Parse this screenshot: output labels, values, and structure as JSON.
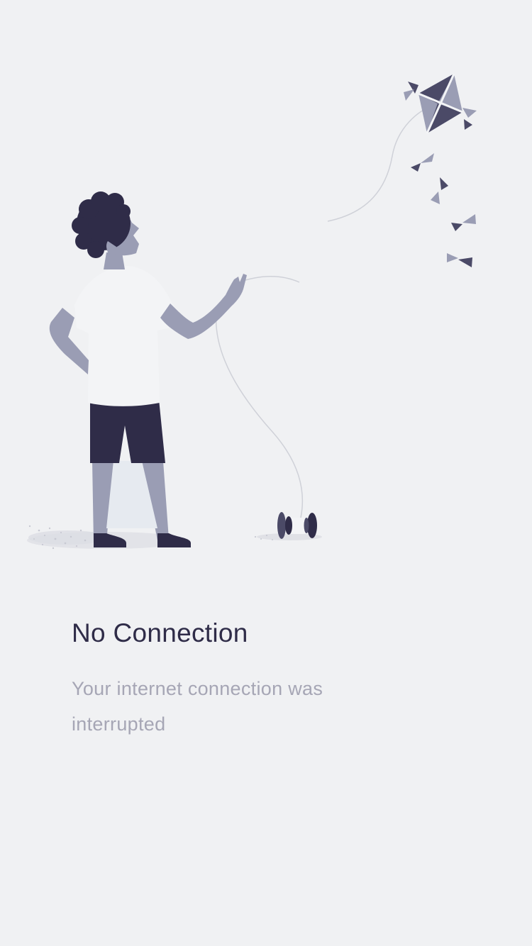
{
  "screen": {
    "title": "No Connection",
    "message": "Your internet connection was interrupted"
  },
  "illustration": {
    "subject": "person-flying-kite",
    "icons": [
      "kite-icon",
      "kite-tail-bow-icon",
      "string-spool-icon"
    ]
  },
  "colors": {
    "background": "#f0f1f3",
    "dark": "#2f2c48",
    "skin": "#9a9db4",
    "shirt": "#f3f4f6",
    "string": "#cfd1d8",
    "title": "#2f2c48",
    "message": "#a6a6b5"
  }
}
